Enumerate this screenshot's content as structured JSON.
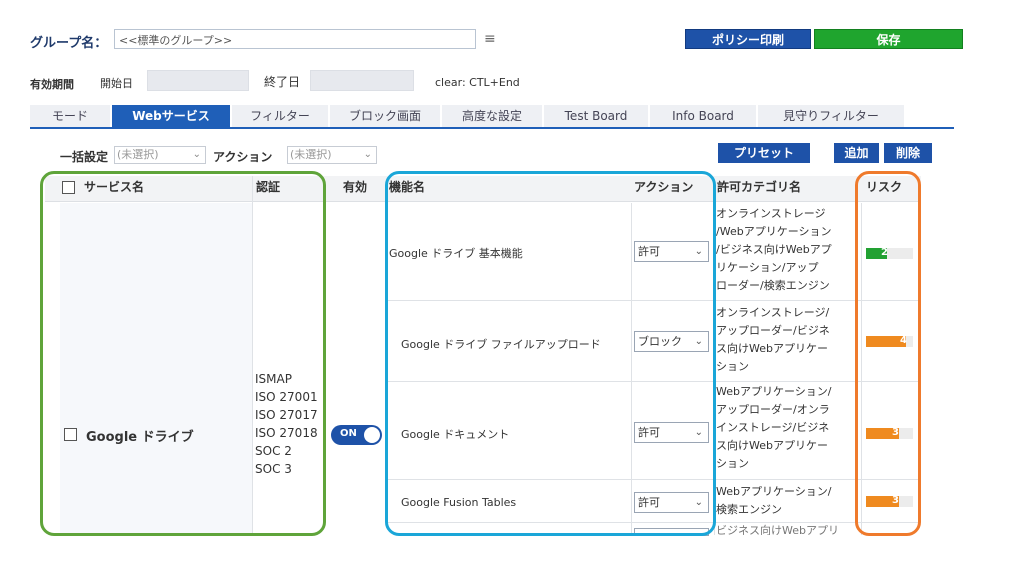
{
  "header": {
    "group_label": "グループ名：",
    "group_value": "<<標準のグループ>>",
    "print_button": "ポリシー印刷",
    "save_button": "保存"
  },
  "period": {
    "label": "有効期間",
    "start_label": "開始日",
    "end_label": "終了日",
    "clear_hint": "clear: CTL+End"
  },
  "tabs": [
    {
      "label": "モード"
    },
    {
      "label": "Webサービス"
    },
    {
      "label": "フィルター"
    },
    {
      "label": "ブロック画面"
    },
    {
      "label": "高度な設定"
    },
    {
      "label": "Test Board"
    },
    {
      "label": "Info Board"
    },
    {
      "label": "見守りフィルター"
    }
  ],
  "bulk": {
    "label": "一括設定",
    "bulk_select": "(未選択)",
    "action_label": "アクション",
    "action_select": "(未選択)",
    "preset_button": "プリセット",
    "add_button": "追加",
    "delete_button": "削除"
  },
  "table": {
    "headers": {
      "service": "サービス名",
      "cert": "認証",
      "enabled": "有効",
      "feature": "機能名",
      "action": "アクション",
      "category": "許可カテゴリ名",
      "risk": "リスク"
    },
    "service": {
      "name": "Google ドライブ",
      "certs": [
        "ISMAP",
        "ISO 27001",
        "ISO 27017",
        "ISO 27018",
        "SOC 2",
        "SOC 3"
      ],
      "toggle": "ON"
    },
    "rows": [
      {
        "feature": "Google ドライブ 基本機能",
        "action": "許可",
        "category_lines": [
          "オンラインストレージ",
          "/Webアプリケーション",
          "/ビジネス向けWebアプ",
          "リケーション/アップ",
          "ローダー/検索エンジン"
        ],
        "risk": 2
      },
      {
        "feature": "Google ドライブ ファイルアップロード",
        "action": "ブロック",
        "category_lines": [
          "オンラインストレージ/",
          "アップローダー/ビジネ",
          "ス向けWebアプリケー",
          "ション"
        ],
        "risk": 4
      },
      {
        "feature": "Google ドキュメント",
        "action": "許可",
        "category_lines": [
          "Webアプリケーション/",
          "アップローダー/オンラ",
          "インストレージ/ビジネ",
          "ス向けWebアプリケー",
          "ション"
        ],
        "risk": 3
      },
      {
        "feature": "Google Fusion Tables",
        "action": "許可",
        "category_lines": [
          "Webアプリケーション/",
          "検索エンジン"
        ],
        "risk": 3
      }
    ],
    "partial_row_text": "ビジネス向けWebアプリ"
  },
  "colors": {
    "brand_blue": "#1e52a8",
    "save_green": "#1fa52e",
    "outline_green": "#5fa43a",
    "outline_blue": "#1aa6d8",
    "outline_orange": "#ef7a2c",
    "risk_green": "#22a132",
    "risk_orange": "#ef8a1f"
  }
}
